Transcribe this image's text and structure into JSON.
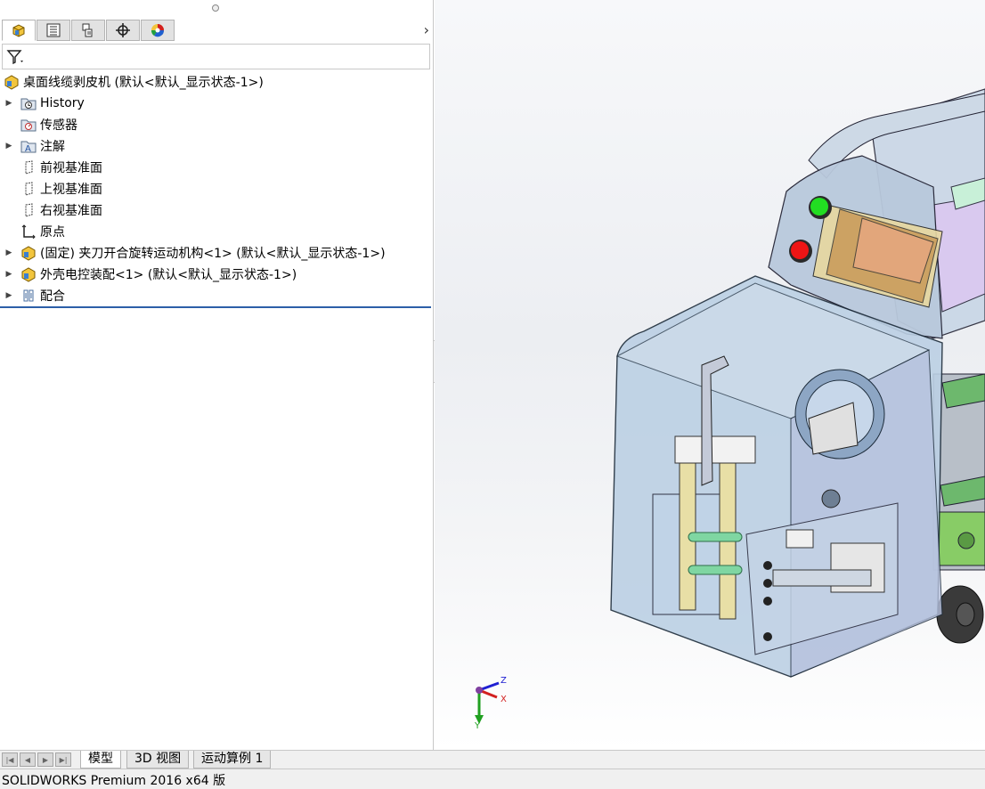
{
  "feature_tree": {
    "root": "桌面线缆剥皮机 (默认<默认_显示状态-1>)",
    "items": [
      {
        "label": "History",
        "expandable": true,
        "icon": "history-folder-icon"
      },
      {
        "label": "传感器",
        "expandable": false,
        "icon": "sensor-icon"
      },
      {
        "label": "注解",
        "expandable": true,
        "icon": "annotation-icon"
      },
      {
        "label": "前视基准面",
        "expandable": false,
        "icon": "plane-icon"
      },
      {
        "label": "上视基准面",
        "expandable": false,
        "icon": "plane-icon"
      },
      {
        "label": "右视基准面",
        "expandable": false,
        "icon": "plane-icon"
      },
      {
        "label": "原点",
        "expandable": false,
        "icon": "origin-icon"
      },
      {
        "label": "(固定) 夹刀开合旋转运动机构<1> (默认<默认_显示状态-1>)",
        "expandable": true,
        "icon": "subassembly-icon"
      },
      {
        "label": "外壳电控装配<1> (默认<默认_显示状态-1>)",
        "expandable": true,
        "icon": "subassembly-icon"
      },
      {
        "label": "配合",
        "expandable": true,
        "icon": "mates-icon"
      }
    ]
  },
  "panel_tabs": [
    "feature-manager",
    "property-manager",
    "configuration-manager",
    "dimxpert-manager",
    "display-manager"
  ],
  "triad": {
    "x": "X",
    "y": "Y",
    "z": "Z"
  },
  "bottom_tabs": [
    "模型",
    "3D 视图",
    "运动算例 1"
  ],
  "status": "SOLIDWORKS Premium 2016 x64 版",
  "colors": {
    "selection_line": "#2c5fa8",
    "triad_x": "#d22020",
    "triad_y": "#20a020",
    "triad_z": "#2020d2"
  }
}
